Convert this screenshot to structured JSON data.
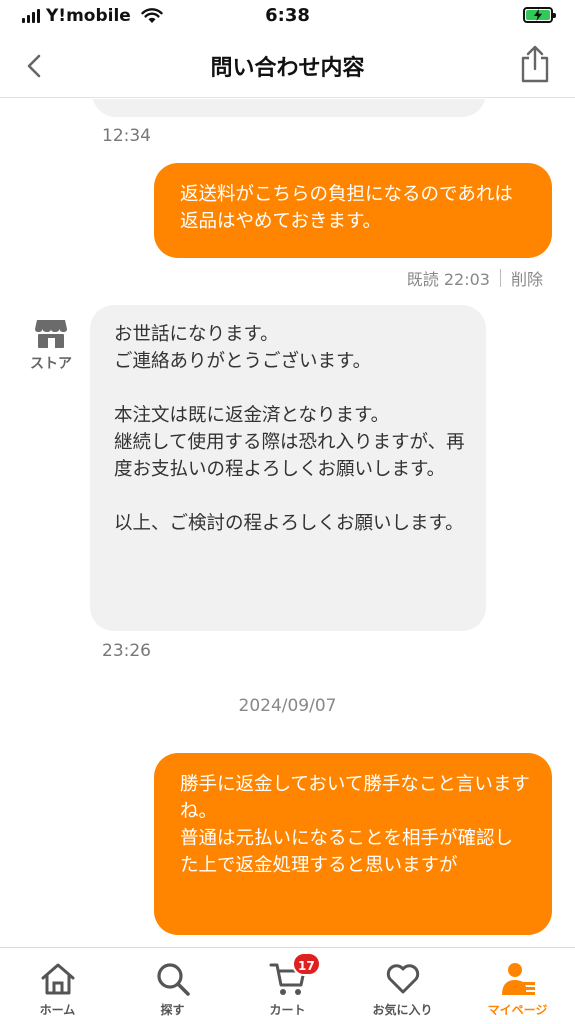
{
  "status_bar": {
    "carrier": "Y!mobile",
    "time": "6:38"
  },
  "header": {
    "title": "問い合わせ内容"
  },
  "messages": {
    "prev_time": "12:34",
    "me_1": {
      "text": "返送料がこちらの負担になるのであれは返品はやめておきます。",
      "read": "既読 22:03",
      "delete": "削除"
    },
    "store_label": "ストア",
    "store_1": {
      "text": "お世話になります。\nご連絡ありがとうございます。\n\n本注文は既に返金済となります。\n継続して使用する際は恐れ入りますが、再度お支払いの程よろしくお願いします。\n\n以上、ご検討の程よろしくお願いします。",
      "time": "23:26"
    },
    "date": "2024/09/07",
    "me_2": {
      "text": "勝手に返金しておいて勝手なこと言いますね。\n普通は元払いになることを相手が確認した上で返金処理すると思いますが"
    }
  },
  "tabbar": {
    "items": [
      {
        "label": "ホーム",
        "icon": "home-icon"
      },
      {
        "label": "探す",
        "icon": "search-icon"
      },
      {
        "label": "カート",
        "icon": "cart-icon",
        "badge": "17"
      },
      {
        "label": "お気に入り",
        "icon": "heart-icon"
      },
      {
        "label": "マイページ",
        "icon": "user-icon"
      }
    ]
  },
  "colors": {
    "accent": "#ff8500",
    "bubble_gray": "#f1f1f1",
    "badge": "#e02020",
    "battery": "#34c759"
  }
}
